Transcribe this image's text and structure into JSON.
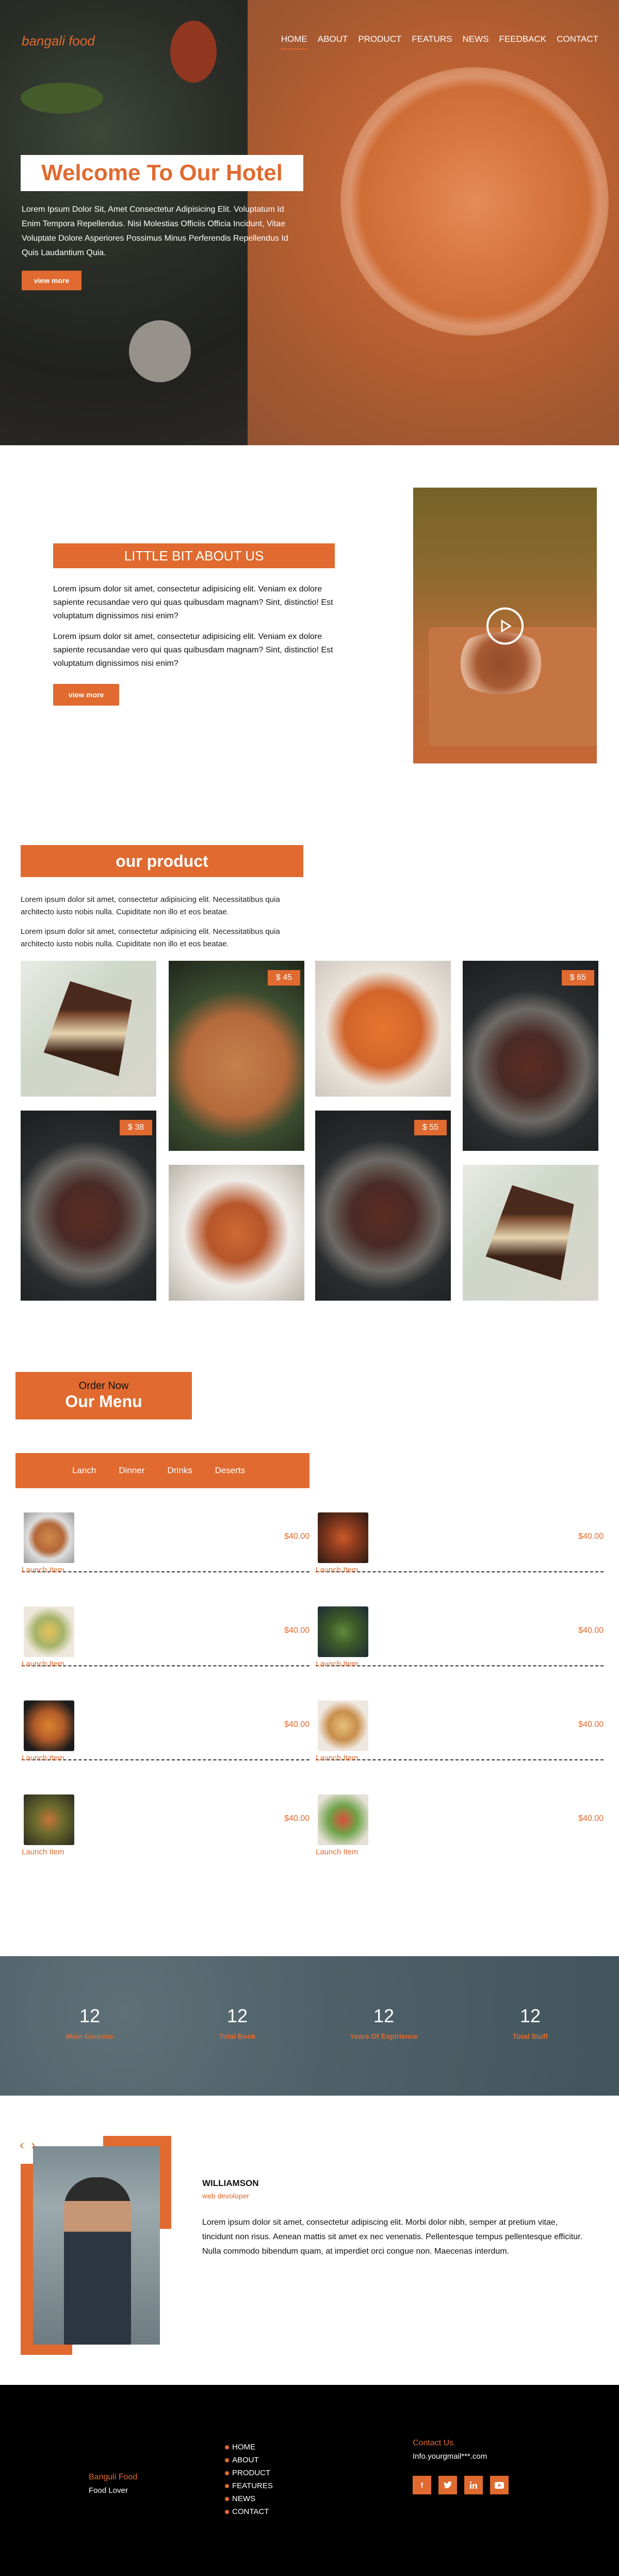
{
  "header": {
    "brand": "bangali food",
    "nav": [
      "HOME",
      "ABOUT",
      "PRODUCT",
      "FEATURS",
      "NEWS",
      "FEEDBACK",
      "CONTACT"
    ]
  },
  "hero": {
    "title": "Welcome To Our Hotel",
    "text": "Lorem Ipsum Dolor Sit, Amet Consectetur Adipisicing Elit. Voluptatum Id Enim Tempora Repellendus. Nisi Molestias Officiis Officia Incidunt, Vitae Voluptate Dolore Asperiores Possimus Minus Perferendis Repellendus Id Quis Laudantium Quia.",
    "button": "view more"
  },
  "about": {
    "title": "LITTLE BIT ABOUT US",
    "p1": "Lorem ipsum dolor sit amet, consectetur adipisicing elit. Veniam ex dolore sapiente recusandae vero qui quas quibusdam magnam? Sint, distinctio! Est voluptatum dignissimos nisi enim?",
    "p2": "Lorem ipsum dolor sit amet, consectetur adipisicing elit. Veniam ex dolore sapiente recusandae vero qui quas quibusdam magnam? Sint, distinctio! Est voluptatum dignissimos nisi enim?",
    "button": "view more"
  },
  "product": {
    "title": "our product",
    "p1": "Lorem ipsum dolor sit amet, consectetur adipisicing elit. Necessitatibus quia architecto iusto nobis nulla. Cupiditate non illo et eos beatae.",
    "p2": "Lorem ipsum dolor sit amet, consectetur adipisicing elit. Necessitatibus quia architecto iusto nobis nulla. Cupiditate non illo et eos beatae.",
    "prices": [
      "$ 45",
      "$ 65",
      "$ 38",
      "$ 55"
    ]
  },
  "menu": {
    "order_now": "Order Now",
    "title": "Our Menu",
    "tabs": [
      "Lanch",
      "Dinner",
      "Drinks",
      "Deserts"
    ],
    "items": [
      {
        "name": "Launch Item",
        "price": "$40.00"
      },
      {
        "name": "Launch Item",
        "price": "$40.00"
      },
      {
        "name": "Launch Item",
        "price": "$40.00"
      },
      {
        "name": "Launch Item",
        "price": "$40.00"
      },
      {
        "name": "Launch Item",
        "price": "$40.00"
      },
      {
        "name": "Launch Item",
        "price": "$40.00"
      },
      {
        "name": "Launch Item",
        "price": "$40.00"
      },
      {
        "name": "Launch Item",
        "price": "$40.00"
      }
    ]
  },
  "stats": [
    {
      "num": "12",
      "label": "Main Courese"
    },
    {
      "num": "12",
      "label": "Total Book"
    },
    {
      "num": "12",
      "label": "Years Of Expirience"
    },
    {
      "num": "12",
      "label": "Total Stuff"
    }
  ],
  "testimonial": {
    "prev": "‹",
    "next": "›",
    "name": "WILLIAMSON",
    "role": "web devoloper",
    "text": "Lorem ipsum dolor sit amet, consectetur adipiscing elit. Morbi dolor nibh, semper at pretium vitae, tincidunt non risus. Aenean mattis sit amet ex nec venenatis. Pellentesque tempus pellentesque efficitur. Nulla commodo bibendum quam, at imperdiet orci congue non. Maecenas interdum."
  },
  "footer": {
    "brand": "Banguli Food",
    "tag": "Food Lover",
    "links": [
      "HOME",
      "ABOUT",
      "PRODUCT",
      "FEATURES",
      "NEWS",
      "CONTACT"
    ],
    "contact_title": "Contact Us",
    "email": "Info.yourgmail***.com",
    "socials": [
      "f",
      "t",
      "in",
      "yt"
    ]
  },
  "colors": {
    "accent": "#e06a2f",
    "footer_bg": "#000000"
  }
}
